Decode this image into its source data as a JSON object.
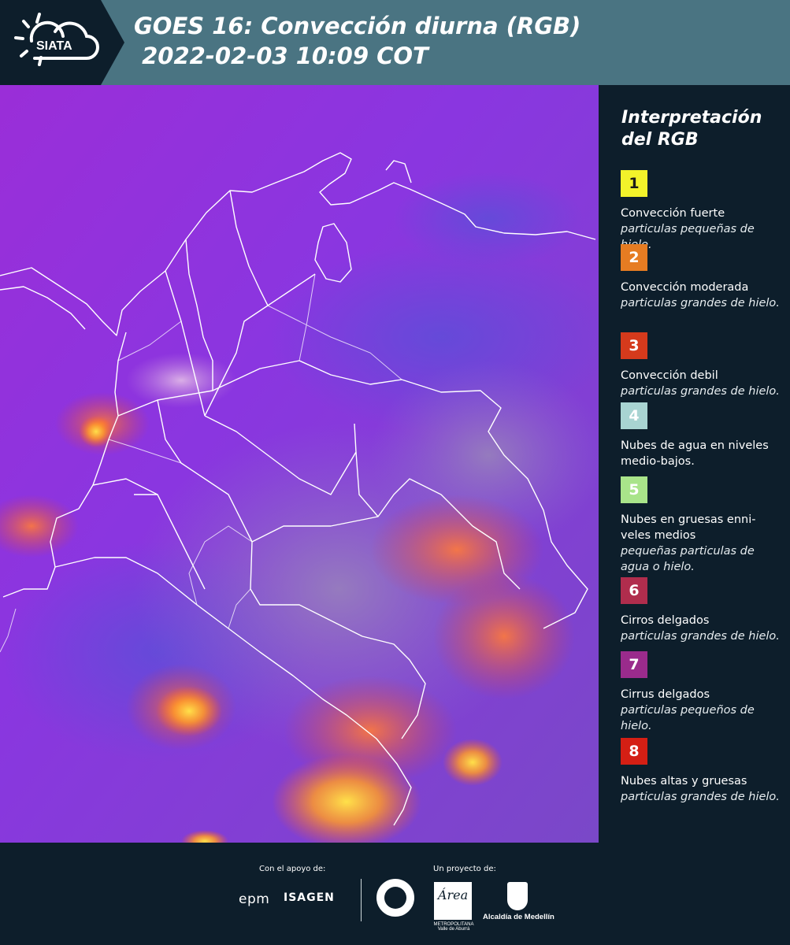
{
  "header": {
    "logo_text": "SIATA",
    "title": "GOES 16: Convección diurna (RGB)\n 2022-02-03 10:09 COT"
  },
  "legend": {
    "title": "Interpretación del RGB",
    "items": [
      {
        "number": "1",
        "name": "Convección fuerte",
        "desc": "particulas pequeñas de hielo.",
        "color": "#f2f22a",
        "text_color": "#1a1a1a"
      },
      {
        "number": "2",
        "name": "Convección moderada",
        "desc": "particulas grandes de hielo.",
        "color": "#e67c22",
        "text_color": "#ffffff"
      },
      {
        "number": "3",
        "name": "Convección debil",
        "desc": "particulas grandes de hielo.",
        "color": "#d53a1c",
        "text_color": "#ffffff"
      },
      {
        "number": "4",
        "name": "Nubes de agua en niveles medio-bajos.",
        "desc": "",
        "color": "#a8d4d2",
        "text_color": "#ffffff"
      },
      {
        "number": "5",
        "name": "Nubes en gruesas enni-veles medios",
        "desc": "pequeñas particulas de agua o hielo.",
        "color": "#a9e48a",
        "text_color": "#ffffff"
      },
      {
        "number": "6",
        "name": "Cirros delgados",
        "desc": "particulas grandes de hielo.",
        "color": "#b02d4d",
        "text_color": "#ffffff"
      },
      {
        "number": "7",
        "name": "Cirrus delgados",
        "desc": "particulas pequeños de hielo.",
        "color": "#9a2b8c",
        "text_color": "#ffffff"
      },
      {
        "number": "8",
        "name": "Nubes altas y gruesas",
        "desc": "particulas grandes de hielo.",
        "color": "#d41f14",
        "text_color": "#ffffff"
      }
    ]
  },
  "footer": {
    "support_label": "Con el apoyo de:",
    "project_label": "Un proyecto de:",
    "sponsor_1": "epm",
    "sponsor_2": "ISAGEN",
    "area_logo_text": "Área",
    "area_caption": "METROPOLITANA Valle de Aburrá",
    "medellin_caption": "Alcaldía de Medellín"
  }
}
